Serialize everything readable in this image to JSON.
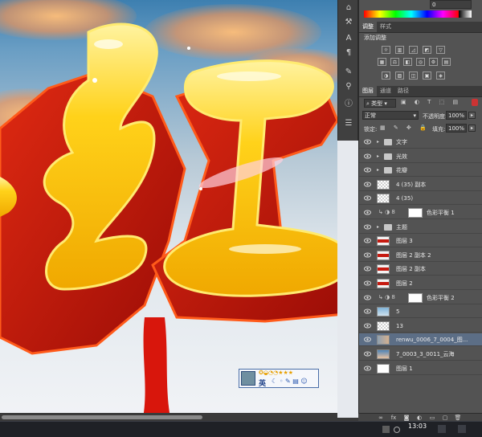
{
  "color_panel": {
    "value": "0"
  },
  "adjust_tabs": [
    "调整",
    "样式"
  ],
  "adjust_title": "添加调整",
  "adjust_icons": [
    "brightness-icon",
    "levels-icon",
    "curves-icon",
    "exposure-icon",
    "vibrance-icon",
    "hue-icon",
    "colorbalance-icon",
    "bw-icon",
    "photofilter-icon",
    "channelmixer-icon",
    "colorlookup-icon",
    "invert-icon",
    "posterize-icon",
    "threshold-icon",
    "gradientmap-icon",
    "selectivecolor-icon"
  ],
  "layers_tabs": [
    "图层",
    "通道",
    "路径"
  ],
  "filter": {
    "kind": "类型"
  },
  "blend": {
    "mode": "正常",
    "opacity_label": "不透明度:",
    "opacity": "100%"
  },
  "lock": {
    "label": "锁定:",
    "fill_label": "填充:",
    "fill": "100%"
  },
  "layers": [
    {
      "name": "文字",
      "type": "group"
    },
    {
      "name": "光效",
      "type": "group"
    },
    {
      "name": "花瓣",
      "type": "group"
    },
    {
      "name": "4 (35) 副本",
      "type": "layer"
    },
    {
      "name": "4 (35)",
      "type": "layer"
    },
    {
      "name": "色彩平衡 1",
      "type": "adjust"
    },
    {
      "name": "主题",
      "type": "group"
    },
    {
      "name": "图层 3",
      "type": "layer"
    },
    {
      "name": "图层 2 副本 2",
      "type": "layer"
    },
    {
      "name": "图层 2 副本",
      "type": "layer"
    },
    {
      "name": "图层 2",
      "type": "layer"
    },
    {
      "name": "色彩平衡 2",
      "type": "adjust"
    },
    {
      "name": "5",
      "type": "layer"
    },
    {
      "name": "13",
      "type": "layer"
    },
    {
      "name": "renwu_0006_7_0004_图...",
      "type": "layer",
      "selected": true
    },
    {
      "name": "7_0003_3_0011_云海",
      "type": "layer"
    },
    {
      "name": "图层 1",
      "type": "layer"
    }
  ],
  "ime": {
    "lang": "英"
  },
  "clock": {
    "time": "13:03"
  },
  "colors": {
    "panel": "#535353",
    "dark": "#3b3b3b",
    "selected": "#5c6e86",
    "gold": "#ffcc00",
    "red": "#c61a10"
  }
}
